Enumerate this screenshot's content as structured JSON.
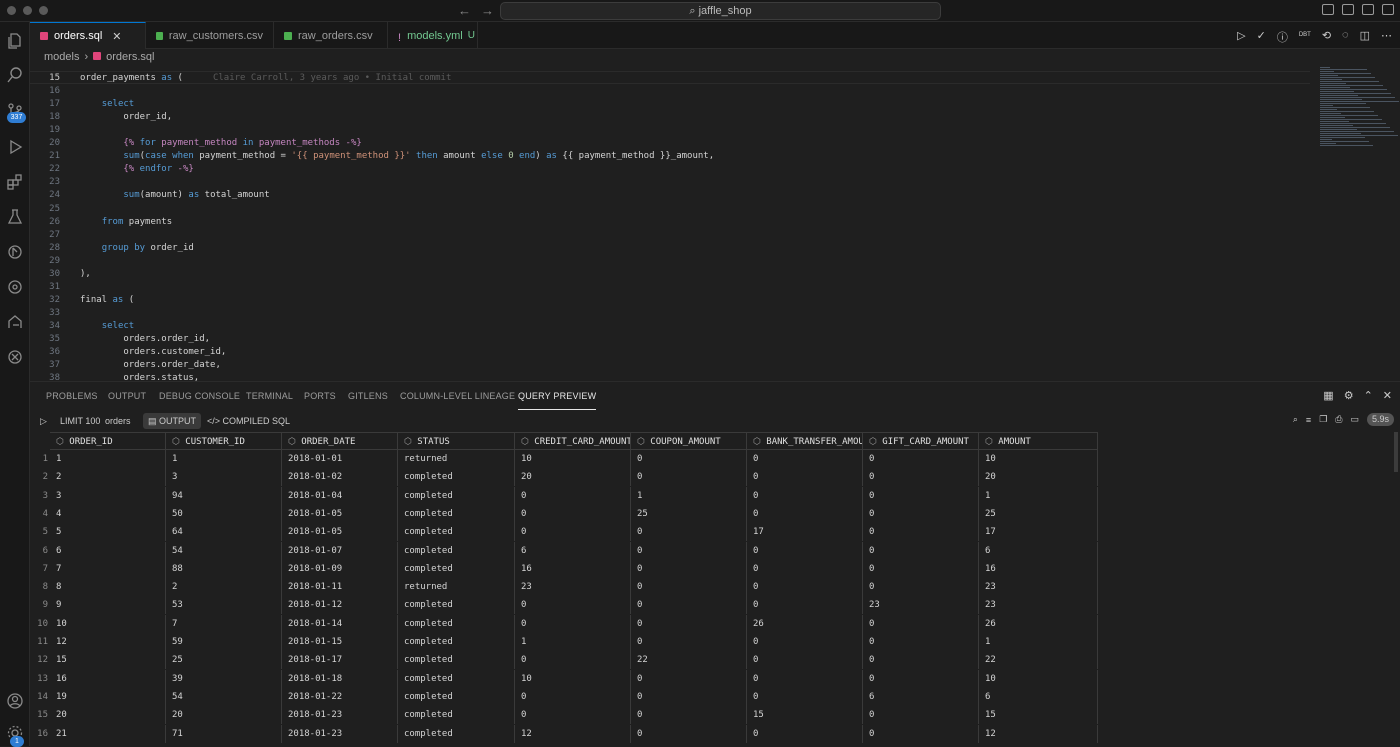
{
  "titlebar": {
    "search_text": "⌕ jaffle_shop"
  },
  "activity": {
    "source_control_badge": "337",
    "accounts_badge": "1"
  },
  "tabs": [
    {
      "label": "orders.sql",
      "icon_color": "#e0457b",
      "active": true,
      "close": "✕",
      "status": ""
    },
    {
      "label": "raw_customers.csv",
      "icon_color": "#4caf50",
      "active": false,
      "close": "",
      "status": ""
    },
    {
      "label": "raw_orders.csv",
      "icon_color": "#4caf50",
      "active": false,
      "close": "",
      "status": ""
    },
    {
      "label": "models.yml",
      "icon_color": "#c586c0",
      "active": false,
      "close": "",
      "status": "U"
    }
  ],
  "breadcrumb": {
    "folder": "models",
    "file": "orders.sql"
  },
  "editor": {
    "current_line": "15",
    "blame": "Claire Carroll, 3 years ago • Initial commit",
    "lines": [
      {
        "n": "15",
        "t": "order_payments as ("
      },
      {
        "n": "16",
        "t": ""
      },
      {
        "n": "17",
        "t": "    select"
      },
      {
        "n": "18",
        "t": "        order_id,"
      },
      {
        "n": "19",
        "t": ""
      },
      {
        "n": "20",
        "t": "        {% for payment_method in payment_methods -%}"
      },
      {
        "n": "21",
        "t": "        sum(case when payment_method = '{{ payment_method }}' then amount else 0 end) as {{ payment_method }}_amount,"
      },
      {
        "n": "22",
        "t": "        {% endfor -%}"
      },
      {
        "n": "23",
        "t": ""
      },
      {
        "n": "24",
        "t": "        sum(amount) as total_amount"
      },
      {
        "n": "25",
        "t": ""
      },
      {
        "n": "26",
        "t": "    from payments"
      },
      {
        "n": "27",
        "t": ""
      },
      {
        "n": "28",
        "t": "    group by order_id"
      },
      {
        "n": "29",
        "t": ""
      },
      {
        "n": "30",
        "t": "),"
      },
      {
        "n": "31",
        "t": ""
      },
      {
        "n": "32",
        "t": "final as ("
      },
      {
        "n": "33",
        "t": ""
      },
      {
        "n": "34",
        "t": "    select"
      },
      {
        "n": "35",
        "t": "        orders.order_id,"
      },
      {
        "n": "36",
        "t": "        orders.customer_id,"
      },
      {
        "n": "37",
        "t": "        orders.order_date,"
      },
      {
        "n": "38",
        "t": "        orders.status,"
      }
    ]
  },
  "panel": {
    "tabs": [
      "PROBLEMS",
      "OUTPUT",
      "DEBUG CONSOLE",
      "TERMINAL",
      "PORTS",
      "GITLENS",
      "COLUMN-LEVEL LINEAGE",
      "QUERY PREVIEW"
    ],
    "active_tab": "QUERY PREVIEW",
    "limit_label": "LIMIT 100",
    "model_name": "orders",
    "output_label": "OUTPUT",
    "compiled_label": "COMPILED SQL",
    "duration": "5.9s"
  },
  "table": {
    "columns": [
      "ORDER_ID",
      "CUSTOMER_ID",
      "ORDER_DATE",
      "STATUS",
      "CREDIT_CARD_AMOUNT",
      "COUPON_AMOUNT",
      "BANK_TRANSFER_AMOUNT",
      "GIFT_CARD_AMOUNT",
      "AMOUNT"
    ],
    "rows": [
      [
        "1",
        "1",
        "2018-01-01",
        "returned",
        "10",
        "0",
        "0",
        "0",
        "10"
      ],
      [
        "2",
        "3",
        "2018-01-02",
        "completed",
        "20",
        "0",
        "0",
        "0",
        "20"
      ],
      [
        "3",
        "94",
        "2018-01-04",
        "completed",
        "0",
        "1",
        "0",
        "0",
        "1"
      ],
      [
        "4",
        "50",
        "2018-01-05",
        "completed",
        "0",
        "25",
        "0",
        "0",
        "25"
      ],
      [
        "5",
        "64",
        "2018-01-05",
        "completed",
        "0",
        "0",
        "17",
        "0",
        "17"
      ],
      [
        "6",
        "54",
        "2018-01-07",
        "completed",
        "6",
        "0",
        "0",
        "0",
        "6"
      ],
      [
        "7",
        "88",
        "2018-01-09",
        "completed",
        "16",
        "0",
        "0",
        "0",
        "16"
      ],
      [
        "8",
        "2",
        "2018-01-11",
        "returned",
        "23",
        "0",
        "0",
        "0",
        "23"
      ],
      [
        "9",
        "53",
        "2018-01-12",
        "completed",
        "0",
        "0",
        "0",
        "23",
        "23"
      ],
      [
        "10",
        "7",
        "2018-01-14",
        "completed",
        "0",
        "0",
        "26",
        "0",
        "26"
      ],
      [
        "12",
        "59",
        "2018-01-15",
        "completed",
        "1",
        "0",
        "0",
        "0",
        "1"
      ],
      [
        "15",
        "25",
        "2018-01-17",
        "completed",
        "0",
        "22",
        "0",
        "0",
        "22"
      ],
      [
        "16",
        "39",
        "2018-01-18",
        "completed",
        "10",
        "0",
        "0",
        "0",
        "10"
      ],
      [
        "19",
        "54",
        "2018-01-22",
        "completed",
        "0",
        "0",
        "0",
        "6",
        "6"
      ],
      [
        "20",
        "20",
        "2018-01-23",
        "completed",
        "0",
        "0",
        "15",
        "0",
        "15"
      ],
      [
        "21",
        "71",
        "2018-01-23",
        "completed",
        "12",
        "0",
        "0",
        "0",
        "12"
      ]
    ]
  }
}
